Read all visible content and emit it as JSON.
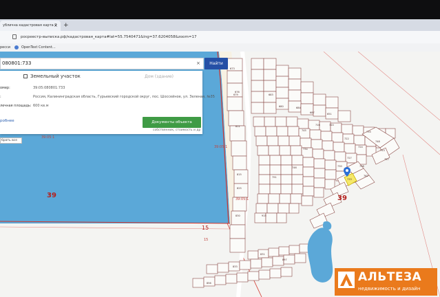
{
  "browser": {
    "tab_title": "ублична кадастровая карта 2",
    "tab_close": "×",
    "tab_new": "+",
    "url": "росреестр-выписка.рф/кадастровая_карта#lat=55.7540471&lng=37.6204058&zoom=17",
    "bookmarks": [
      "ресси",
      "OpenText Content..."
    ]
  },
  "search": {
    "value": "080801:733",
    "clear": "×",
    "button": "Найти"
  },
  "panel": {
    "tab_active": "Земельный участок",
    "tab_inactive": "Дом (здание)",
    "rows": [
      {
        "label": "омер:",
        "value": "39:05:080801:733"
      },
      {
        "label": ":",
        "value": "Россия, Калининградская область, Гурьевский городской округ, пос. Шоссейное, ул. Зеленая, №35"
      },
      {
        "label": "лечная площадь:",
        "value": "600 кв.м"
      }
    ],
    "detail_link": "робнее",
    "docs_button": "Документы объекта",
    "note": "собственник, стоимость и др"
  },
  "map": {
    "reset_button": "брать все",
    "labels": [
      "39",
      "39",
      "15",
      "15",
      "39:05:1",
      "39:05:1",
      "39:05:1"
    ],
    "parcel_labels": [
      "673",
      "676",
      "679",
      "680",
      "683",
      "684",
      "716",
      "720",
      "687",
      "651",
      "735",
      "748",
      "753",
      "757",
      "758",
      "762",
      "722",
      "724",
      "727",
      "730",
      "745",
      "734",
      "733",
      "746",
      "791",
      "811",
      "815",
      "825",
      "830",
      "831",
      "833",
      "856",
      "897",
      "915"
    ]
  },
  "logo": {
    "name": "АЛЬТЕЗА",
    "tagline": "недвижимость и дизайн"
  }
}
